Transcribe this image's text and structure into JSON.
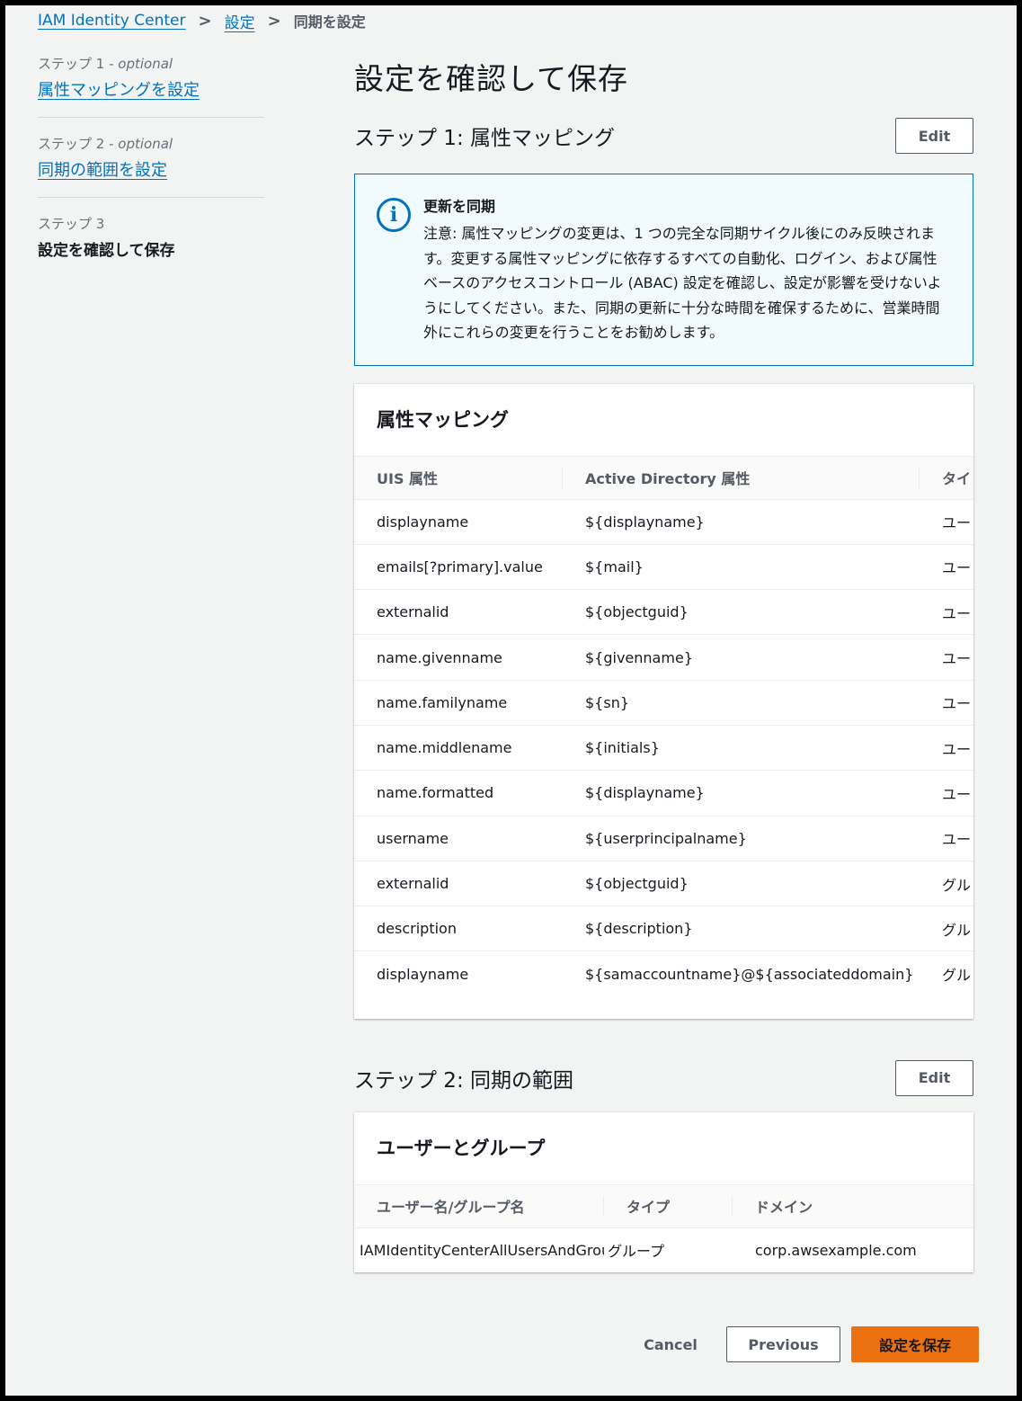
{
  "breadcrumb": {
    "items": [
      "IAM Identity Center",
      "設定"
    ],
    "current": "同期を設定"
  },
  "wizard": {
    "steps": [
      {
        "num": "ステップ 1",
        "optional": "optional",
        "label": "属性マッピングを設定"
      },
      {
        "num": "ステップ 2",
        "optional": "optional",
        "label": "同期の範囲を設定"
      },
      {
        "num": "ステップ 3",
        "label": "設定を確認して保存"
      }
    ]
  },
  "page_title": "設定を確認して保存",
  "step1": {
    "title": "ステップ 1: 属性マッピング",
    "edit_label": "Edit",
    "alert": {
      "title": "更新を同期",
      "body": "注意: 属性マッピングの変更は、1 つの完全な同期サイクル後にのみ反映されます。変更する属性マッピングに依存するすべての自動化、ログイン、および属性ベースのアクセスコントロール (ABAC) 設定を確認し、設定が影響を受けないようにしてください。また、同期の更新に十分な時間を確保するために、営業時間外にこれらの変更を行うことをお勧めします。"
    },
    "table": {
      "title": "属性マッピング",
      "columns": [
        "UIS 属性",
        "Active Directory 属性",
        "タイ"
      ],
      "rows": [
        [
          "displayname",
          "${displayname}",
          "ユー"
        ],
        [
          "emails[?primary].value",
          "${mail}",
          "ユー"
        ],
        [
          "externalid",
          "${objectguid}",
          "ユー"
        ],
        [
          "name.givenname",
          "${givenname}",
          "ユー"
        ],
        [
          "name.familyname",
          "${sn}",
          "ユー"
        ],
        [
          "name.middlename",
          "${initials}",
          "ユー"
        ],
        [
          "name.formatted",
          "${displayname}",
          "ユー"
        ],
        [
          "username",
          "${userprincipalname}",
          "ユー"
        ],
        [
          "externalid",
          "${objectguid}",
          "グル"
        ],
        [
          "description",
          "${description}",
          "グル"
        ],
        [
          "displayname",
          "${samaccountname}@${associateddomain}",
          "グル"
        ]
      ]
    }
  },
  "step2": {
    "title": "ステップ 2: 同期の範囲",
    "edit_label": "Edit",
    "table": {
      "title": "ユーザーとグループ",
      "columns": [
        "ユーザー名/グループ名",
        "タイプ",
        "ドメイン"
      ],
      "rows": [
        [
          "IAMIdentityCenterAllUsersAndGroups",
          "グループ",
          "corp.awsexample.com"
        ]
      ]
    }
  },
  "footer": {
    "cancel_label": "Cancel",
    "previous_label": "Previous",
    "save_label": "設定を保存"
  },
  "colors": {
    "link": "#0073bb",
    "primary_button": "#ec7211",
    "alert_bg": "#f1faff",
    "page_bg": "#f2f3f3"
  }
}
